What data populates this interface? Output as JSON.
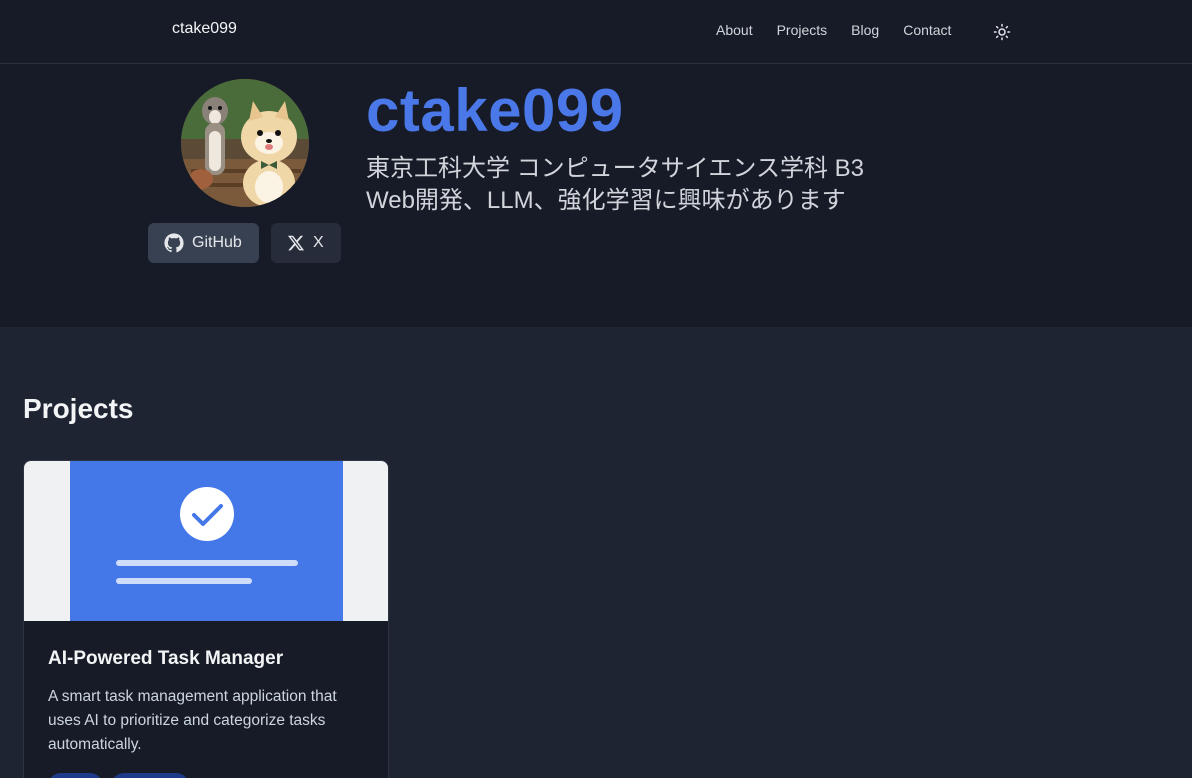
{
  "header": {
    "brand": "ctake099",
    "nav": [
      "About",
      "Projects",
      "Blog",
      "Contact"
    ],
    "theme_toggle_icon": "sun-icon"
  },
  "hero": {
    "name": "ctake099",
    "line1": "東京工科大学 コンピュータサイエンス学科 B3",
    "line2": "Web開発、LLM、強化学習に興味があります",
    "github_label": "GitHub",
    "x_label": "X",
    "accent_color": "#4b78e8"
  },
  "projects": {
    "title": "Projects",
    "cards": [
      {
        "title": "AI-Powered Task Manager",
        "description": "A smart task management application that uses AI to prioritize and categorize tasks automatically."
      }
    ]
  }
}
